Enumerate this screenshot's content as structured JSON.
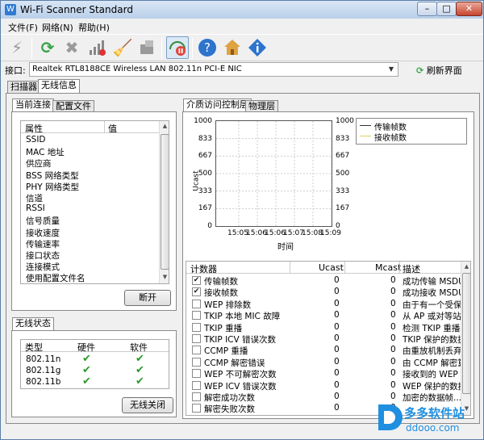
{
  "window": {
    "title": "Wi-Fi Scanner Standard",
    "min": "–",
    "max": "□",
    "close": "✕"
  },
  "menu": [
    "文件(F)",
    "网络(N)",
    "帮助(H)"
  ],
  "toolbar": {
    "icons": [
      "lightning-icon",
      "refresh-icon",
      "stop-icon",
      "signal-icon",
      "broom-icon",
      "export-icon",
      "pause-icon",
      "help-icon",
      "home-icon",
      "about-icon"
    ]
  },
  "interface": {
    "label": "接口:",
    "value": "Realtek RTL8188CE Wireless LAN 802.11n PCI-E NIC",
    "refresh": "刷新界面"
  },
  "top_tabs": [
    "扫描器",
    "无线信息"
  ],
  "left": {
    "tabs": [
      "当前连接",
      "配置文件"
    ],
    "headers": [
      "属性",
      "值"
    ],
    "props": [
      "SSID",
      "MAC 地址",
      "供应商",
      "BSS 网络类型",
      "PHY 网络类型",
      "信道",
      "RSSI",
      "信号质量",
      "接收速度",
      "传输速率",
      "接口状态",
      "连接模式",
      "使用配置文件名"
    ],
    "disconnect": "断开"
  },
  "status": {
    "title": "无线状态",
    "headers": [
      "类型",
      "硬件",
      "软件"
    ],
    "rows": [
      "802.11n",
      "802.11g",
      "802.11b"
    ],
    "off_button": "无线关闭"
  },
  "right": {
    "tabs": [
      "介质访问控制层",
      "物理层"
    ],
    "ylabel": "Ucast",
    "xlabel": "时间",
    "yticks": [
      "1000",
      "833",
      "667",
      "500",
      "333",
      "167",
      "0"
    ],
    "xticks": [
      "15:05",
      "15:06",
      "15:06",
      "15:07",
      "15:08",
      "15:09"
    ],
    "legend": [
      "传输帧数",
      "接收帧数"
    ],
    "counters_header": [
      "计数器",
      "Ucast",
      "Mcast",
      "描述"
    ],
    "counters": [
      {
        "name": "传输帧数",
        "ucast": "0",
        "mcast": "0",
        "desc": "成功传输 MSDU/...",
        "checked": true
      },
      {
        "name": "接收帧数",
        "ucast": "0",
        "mcast": "0",
        "desc": "成功接收 MSDU/...",
        "checked": true
      },
      {
        "name": "WEP 排除数",
        "ucast": "0",
        "mcast": "0",
        "desc": "由于有一个受保...",
        "checked": false
      },
      {
        "name": "TKIP 本地 MIC 故障",
        "ucast": "0",
        "mcast": "0",
        "desc": "从 AP 或对等站接...",
        "checked": false
      },
      {
        "name": "TKIP 重播",
        "ucast": "0",
        "mcast": "0",
        "desc": "检测 TKIP 重播的...",
        "checked": false
      },
      {
        "name": "TKIP ICV 错误次数",
        "ucast": "0",
        "mcast": "0",
        "desc": "TKIP 保护的数据...",
        "checked": false
      },
      {
        "name": "CCMP 重播",
        "ucast": "0",
        "mcast": "0",
        "desc": "由重放机制丢弃...",
        "checked": false
      },
      {
        "name": "CCMP 解密错误",
        "ucast": "0",
        "mcast": "0",
        "desc": "由 CCMP 解密算...",
        "checked": false
      },
      {
        "name": "WEP 不可解密次数",
        "ucast": "0",
        "mcast": "0",
        "desc": "接收到的 WEP 保...",
        "checked": false
      },
      {
        "name": "WEP ICV 错误次数",
        "ucast": "0",
        "mcast": "0",
        "desc": "WEP 保护的数据...",
        "checked": false
      },
      {
        "name": "解密成功次数",
        "ucast": "0",
        "mcast": "0",
        "desc": "加密的数据帧...",
        "checked": false
      },
      {
        "name": "解密失败次数",
        "ucast": "0",
        "mcast": "0",
        "desc": "",
        "checked": false
      }
    ]
  },
  "watermark": {
    "brand": "多多软件站",
    "url": "ddooo.com"
  },
  "chart_data": {
    "type": "line",
    "ylabel": "Ucast",
    "xlabel": "时间",
    "ylim": [
      0,
      1000
    ],
    "x": [
      "15:05",
      "15:06",
      "15:06",
      "15:07",
      "15:08",
      "15:09"
    ],
    "series": [
      {
        "name": "传输帧数",
        "values": []
      },
      {
        "name": "接收帧数",
        "values": []
      }
    ],
    "grid": true,
    "legend": "right"
  }
}
